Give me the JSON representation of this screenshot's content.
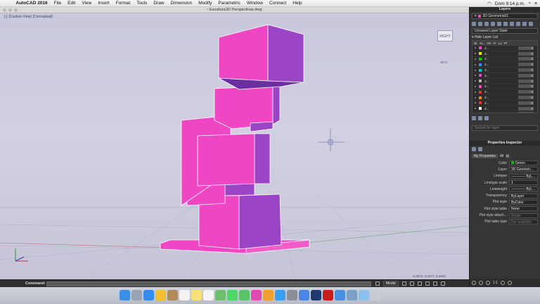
{
  "menubar": {
    "app_name": "AutoCAD 2016",
    "items": [
      "File",
      "Edit",
      "View",
      "Insert",
      "Format",
      "Tools",
      "Draw",
      "Dimension",
      "Modify",
      "Parametric",
      "Window",
      "Connect",
      "Help"
    ],
    "clock": "Dom 9:14 p.m."
  },
  "document": {
    "title": "Escultura3D Perspectivas.dwg",
    "viewport_controls": [
      "[-]",
      "[Custom View]",
      "[Conceptual]"
    ],
    "viewcube_label": "RIGHT",
    "wcs_label": "WCS"
  },
  "coords": "-5.3574, 2.0077, 0.0000",
  "command": {
    "label": "Command:",
    "value": ""
  },
  "status": {
    "model_tab": "Model",
    "scale": "1:1"
  },
  "layers_panel": {
    "title": "Layers",
    "current_layer": "3D Geometria01",
    "current_color": "#e64bbf",
    "layer_state": "Unsaved Layer State",
    "hide_list_label": "Hide Layer List",
    "columns": [
      "St.",
      "N...",
      "On",
      "Fr",
      "Lo",
      "Pl"
    ],
    "rows": [
      {
        "name": "Z...",
        "color": "#e64bbf",
        "value": "0"
      },
      {
        "name": "Z...",
        "color": "#e6e600",
        "value": "0"
      },
      {
        "name": "Z...",
        "color": "#00d000",
        "value": "0"
      },
      {
        "name": "Z...",
        "color": "#3c8cff",
        "value": "0"
      },
      {
        "name": "Z...",
        "color": "#00c8c8",
        "value": "0"
      },
      {
        "name": "Z...",
        "color": "#e64bbf",
        "value": "0"
      },
      {
        "name": "Z...",
        "color": "#b0b0b0",
        "value": "0"
      },
      {
        "name": "Z...",
        "color": "#e64bbf",
        "value": "0"
      },
      {
        "name": "Z...",
        "color": "#e63232",
        "value": "0"
      },
      {
        "name": "Z...",
        "color": "#e68c00",
        "value": "0"
      },
      {
        "name": "Z...",
        "color": "#e63232",
        "value": "0"
      },
      {
        "name": "Z...",
        "color": "#ffffff",
        "value": "0"
      },
      {
        "name": "Z...",
        "color": "#d0d0d0",
        "value": "90"
      }
    ],
    "search_placeholder": "Search for layer"
  },
  "properties_panel": {
    "title": "Properties Inspector",
    "filter_label": "My Properties",
    "filter_all": "All",
    "rows": [
      {
        "label": "Color",
        "value": "Green",
        "swatch": "#00c000"
      },
      {
        "label": "Layer",
        "value": "3D Geometr..."
      },
      {
        "label": "Linetype",
        "value": "———— ByL..."
      },
      {
        "label": "Linetype scale",
        "value": "1"
      },
      {
        "label": "Lineweight",
        "value": "———— ByL..."
      },
      {
        "label": "Transparency",
        "value": "ByLayer"
      },
      {
        "label": "Plot style",
        "value": "ByColor"
      },
      {
        "label": "Plot style table",
        "value": "None"
      },
      {
        "label": "Plot style attach...",
        "value": "Model"
      },
      {
        "label": "Plot table type",
        "value": "Not available"
      }
    ]
  },
  "dock": {
    "icons": [
      "finder-icon",
      "launchpad-icon",
      "safari-icon",
      "photos-icon",
      "contacts-icon",
      "calendar-icon",
      "notes-icon",
      "reminders-icon",
      "maps-icon",
      "messages-icon",
      "facetime-icon",
      "itunes-icon",
      "ibooks-icon",
      "appstore-icon",
      "preferences-icon",
      "chrome-icon",
      "photoshop-icon",
      "autocad-icon",
      "downloads-icon",
      "preview-icon",
      "folder-icon",
      "trash-icon"
    ],
    "colors": [
      "#3a8ee6",
      "#9aa4b4",
      "#2f8ef0",
      "#f0c030",
      "#b08a5a",
      "#f2f2f2",
      "#f7e27a",
      "#f4f4f4",
      "#6cc06c",
      "#4cd964",
      "#58c46a",
      "#e04ab0",
      "#f0a030",
      "#3a9ef0",
      "#8a8f99",
      "#4a86e8",
      "#1e3a6e",
      "#c81e1e",
      "#4a90e2",
      "#7aa0c8",
      "#8ec0ee",
      "#c7ccd4"
    ]
  },
  "colors": {
    "sculpture_front": "#ef46c3",
    "sculpture_side": "#9c44c6",
    "sculpture_top": "#f6a0e0",
    "background": "#cccbde",
    "grid": "#aeb0c4"
  }
}
